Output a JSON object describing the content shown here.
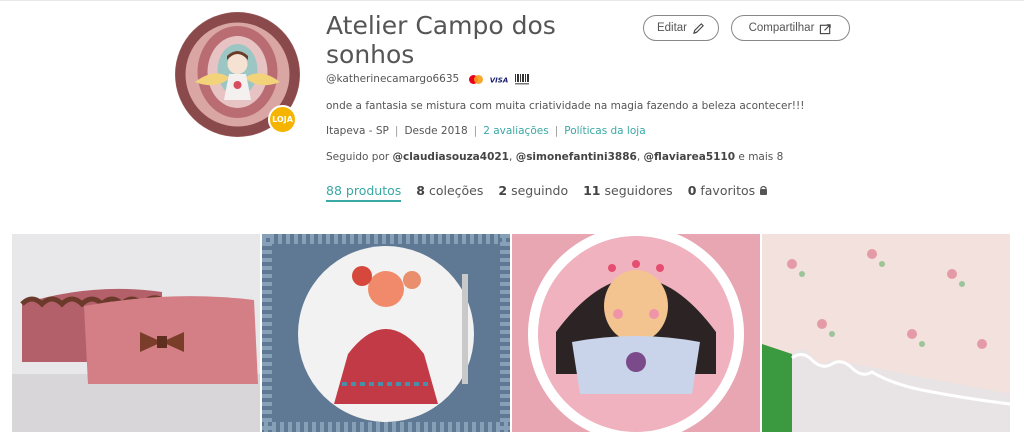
{
  "store": {
    "name": "Atelier Campo dos sonhos",
    "badge": "LOJA",
    "username": "@katherinecamargo6635",
    "payments": [
      "mastercard-icon",
      "visa-icon",
      "boleto-icon"
    ],
    "description": "onde a fantasia se mistura com muita criatividade na magia fazendo a beleza acontecer!!!",
    "location": "Itapeva - SP",
    "since": "Desde 2018",
    "reviews_link": "2 avaliações",
    "policies_link": "Políticas da loja",
    "followed_by_prefix": "Seguido por",
    "followers_preview": [
      "@claudiasouza4021",
      "@simonefantini3886",
      "@flaviarea5110"
    ],
    "followed_by_suffix": "e mais 8"
  },
  "actions": {
    "edit_label": "Editar",
    "share_label": "Compartilhar"
  },
  "stats": [
    {
      "num": "88",
      "label": "produtos",
      "active": true
    },
    {
      "num": "8",
      "label": "coleções",
      "active": false
    },
    {
      "num": "2",
      "label": "seguindo",
      "active": false
    },
    {
      "num": "11",
      "label": "seguidores",
      "active": false
    },
    {
      "num": "0",
      "label": "favoritos",
      "active": false
    }
  ],
  "colors": {
    "accent": "#3aa8a4",
    "badge": "#f4b400"
  }
}
